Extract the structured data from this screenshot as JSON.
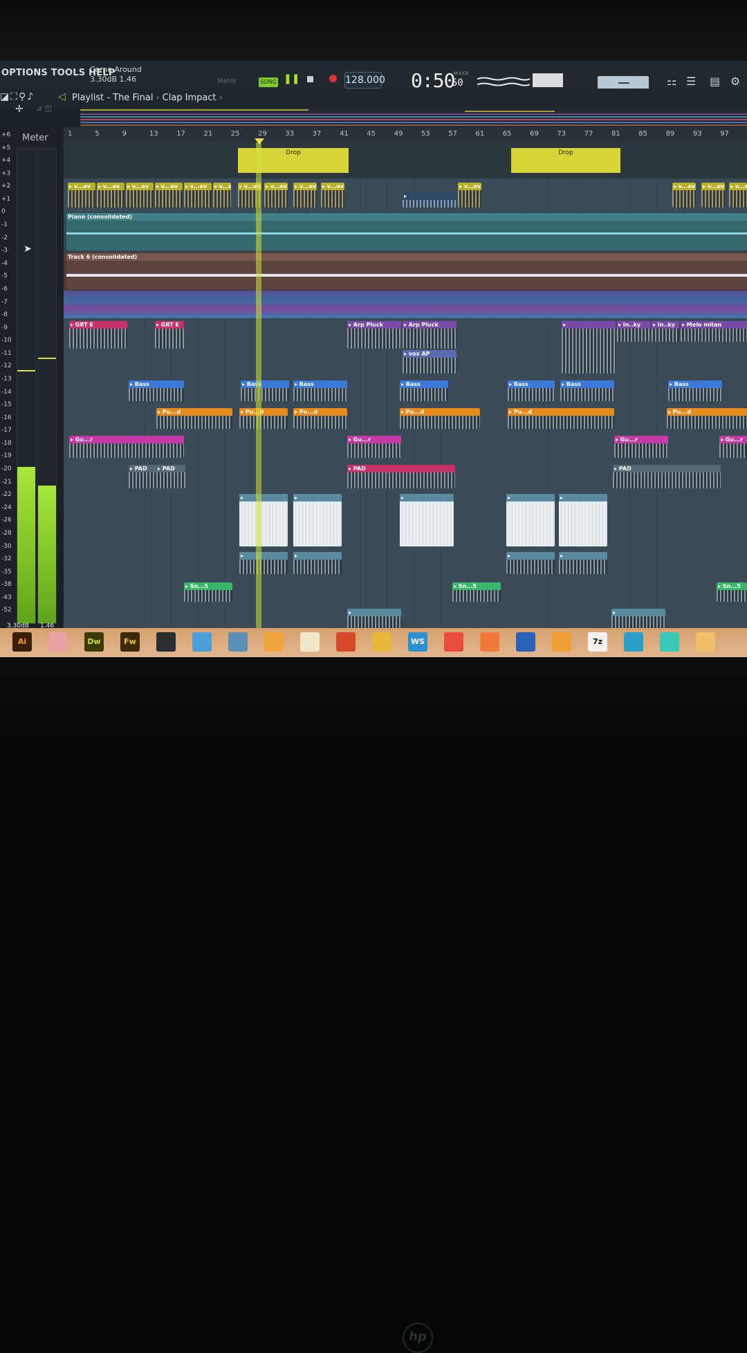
{
  "menu": {
    "options": "OPTIONS",
    "tools": "TOOLS",
    "help": "HELP"
  },
  "hint": {
    "line1": "Come Around",
    "line2": "3.30dB  1.46"
  },
  "transport": {
    "meter_label": "Meter",
    "mode": "SONG",
    "tempo": "128.000",
    "time_main": "0:50",
    "time_sub": "50",
    "time_units": "M:S:CS"
  },
  "breadcrumb": {
    "playlist": "Playlist - The Final",
    "pattern": "Clap Impact"
  },
  "meter": {
    "title": "Meter",
    "readout_db": "3.30dB",
    "readout_val": "1.46",
    "left_level": 0.33,
    "right_level": 0.29,
    "scale": [
      "+6",
      "+5",
      "+4",
      "+3",
      "+2",
      "+1",
      "0",
      "-1",
      "-2",
      "-3",
      "-4",
      "-5",
      "-6",
      "-7",
      "-8",
      "-9",
      "-10",
      "-11",
      "-12",
      "-13",
      "-14",
      "-15",
      "-16",
      "-17",
      "-18",
      "-19",
      "-20",
      "-21",
      "-22",
      "-24",
      "-26",
      "-28",
      "-30",
      "-32",
      "-35",
      "-38",
      "-43",
      "-52"
    ]
  },
  "ruler": [
    "1",
    "5",
    "9",
    "13",
    "17",
    "21",
    "25",
    "29",
    "33",
    "37",
    "41",
    "45",
    "49",
    "53",
    "57",
    "61",
    "65",
    "69",
    "73",
    "77",
    "81",
    "85",
    "89",
    "93",
    "97"
  ],
  "markers": [
    "Drop",
    "Drop"
  ],
  "tracks": {
    "vocal_clips": [
      "v...ev",
      "v...ev",
      "v...ev",
      "v...ev",
      "v...ev",
      "v...ev",
      "v...ev",
      "v...ev",
      "v...ev",
      "v...ev",
      "v...ev",
      "v...ev"
    ],
    "piano": "Piano (consolidated)",
    "track6": "Track 6 (consolidated)",
    "grt": [
      "GRT E",
      "GRT E"
    ],
    "arp": [
      "Arp Pluck",
      "Arp Pluck"
    ],
    "vox": "vox AP",
    "inky": [
      "In..ky",
      "In..ky"
    ],
    "melo": "Melo mitan",
    "bass": "Bass",
    "pu": "Pu...d",
    "gu": "Gu...r",
    "pad": "PAD",
    "sn": "Sn...5"
  },
  "taskbar": [
    {
      "label": "Ai",
      "color": "#3a1f08",
      "fg": "#ff9a1f"
    },
    {
      "label": "",
      "color": "#e8a2a2",
      "fg": "#fff"
    },
    {
      "label": "Dw",
      "color": "#3c3a06",
      "fg": "#c9e23a"
    },
    {
      "label": "Fw",
      "color": "#3a2a06",
      "fg": "#f2c43a"
    },
    {
      "label": "",
      "color": "#2a2e31",
      "fg": "#fff"
    },
    {
      "label": "",
      "color": "#4a9fd8",
      "fg": "#fff"
    },
    {
      "label": "",
      "color": "#5b8fb3",
      "fg": "#fff"
    },
    {
      "label": "",
      "color": "#f0a43a",
      "fg": "#fff"
    },
    {
      "label": "",
      "color": "#f0e8c8",
      "fg": "#fff"
    },
    {
      "label": "",
      "color": "#d64a2a",
      "fg": "#fff"
    },
    {
      "label": "",
      "color": "#e8b83a",
      "fg": "#fff"
    },
    {
      "label": "WS",
      "color": "#2b8fd0",
      "fg": "#fff"
    },
    {
      "label": "",
      "color": "#e94b3c",
      "fg": "#fff"
    },
    {
      "label": "",
      "color": "#f07a3a",
      "fg": "#fff"
    },
    {
      "label": "",
      "color": "#2a62b8",
      "fg": "#fff"
    },
    {
      "label": "",
      "color": "#f0a032",
      "fg": "#fff"
    },
    {
      "label": "7z",
      "color": "#f2f2f2",
      "fg": "#111"
    },
    {
      "label": "",
      "color": "#2aa0c8",
      "fg": "#fff"
    },
    {
      "label": "",
      "color": "#3ac8b8",
      "fg": "#fff"
    },
    {
      "label": "",
      "color": "#f0c06a",
      "fg": "#fff"
    }
  ]
}
